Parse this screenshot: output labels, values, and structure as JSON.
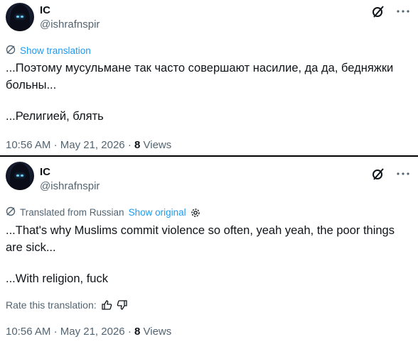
{
  "tweet1": {
    "name": "IC",
    "handle": "@ishrafnspir",
    "show_translation": "Show translation",
    "line1": "...Поэтому мусульмане так часто совершают насилие, да да, бедняжки больны...",
    "line2": "...Религией, блять",
    "time": "10:56 AM",
    "date": "May 21, 2026",
    "views_count": "8",
    "views_label": "Views"
  },
  "tweet2": {
    "name": "IC",
    "handle": "@ishrafnspir",
    "translated_from": "Translated from Russian",
    "show_original": "Show original",
    "line1": "...That's why Muslims commit violence so often, yeah yeah, the poor things are sick...",
    "line2": "...With religion, fuck",
    "rate_label": "Rate this translation:",
    "time": "10:56 AM",
    "date": "May 21, 2026",
    "views_count": "8",
    "views_label": "Views"
  },
  "sep": "·",
  "icons": {
    "grok": "grok-slash-icon",
    "more": "more-horizontal-icon",
    "translate": "translate-icon",
    "gear": "gear-icon",
    "thumb_up": "thumbs-up-icon",
    "thumb_down": "thumbs-down-icon"
  },
  "colors": {
    "link": "#1d9bf0",
    "muted": "#536471",
    "text": "#0f1419"
  }
}
